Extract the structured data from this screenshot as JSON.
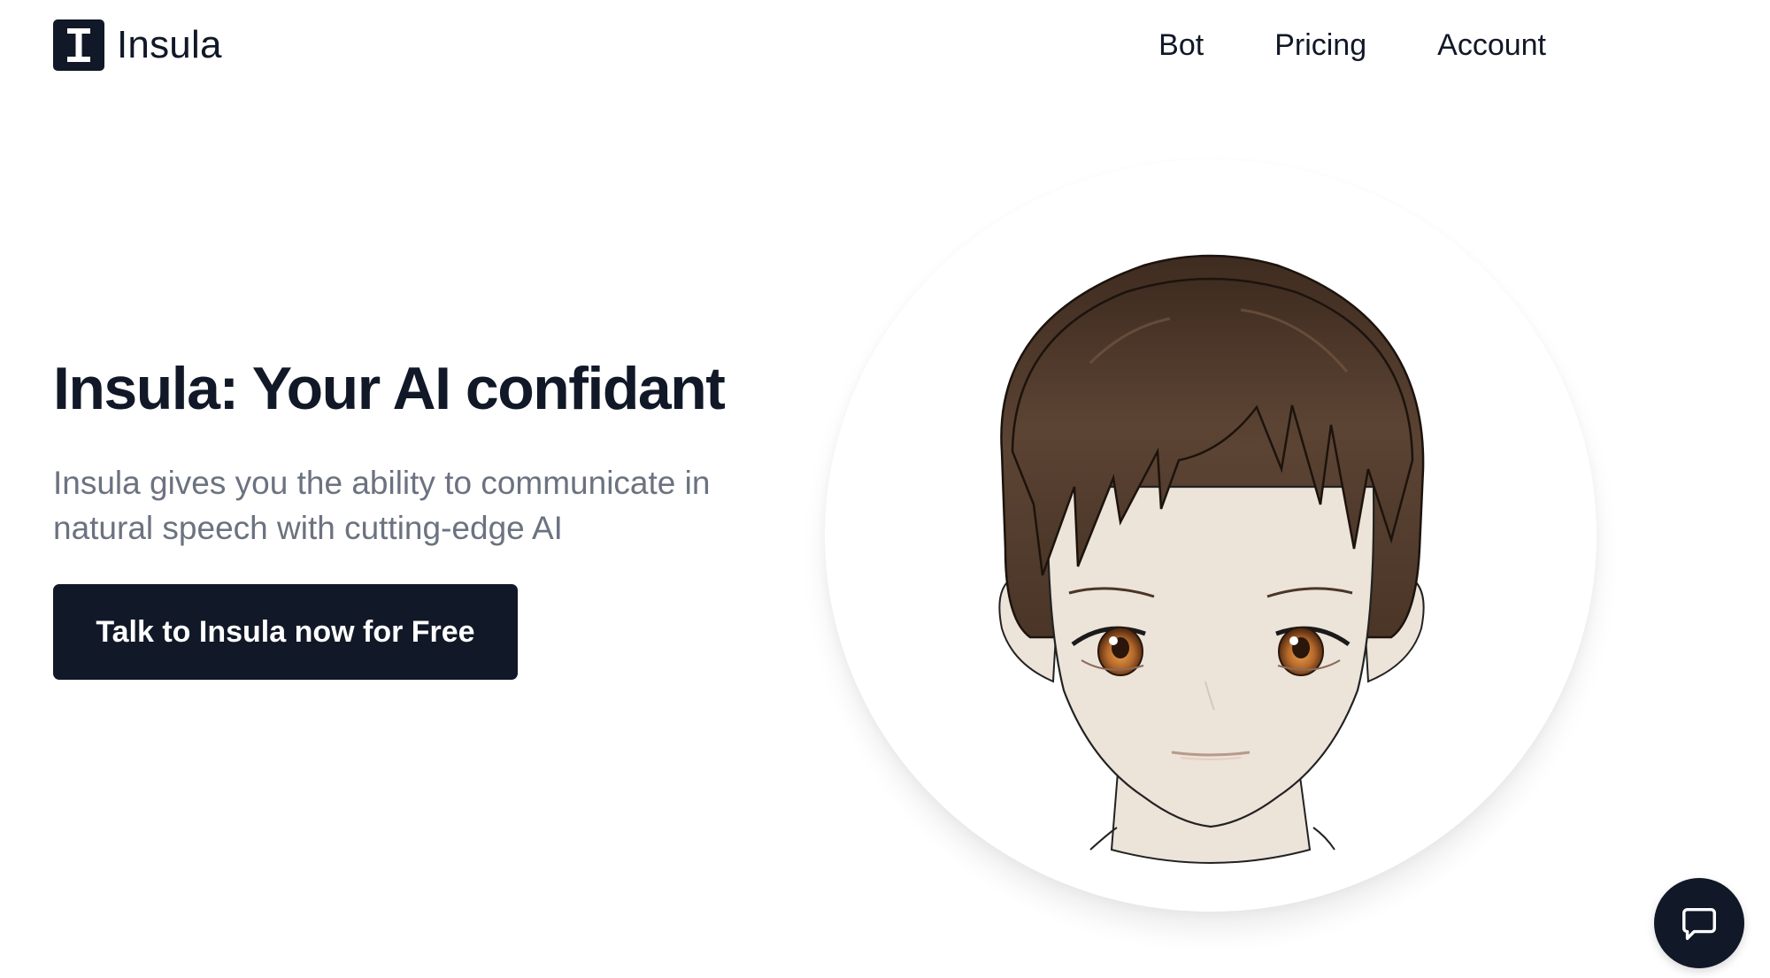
{
  "brand": {
    "name": "Insula",
    "logo_letter": "I"
  },
  "nav": {
    "items": [
      {
        "label": "Bot"
      },
      {
        "label": "Pricing"
      },
      {
        "label": "Account"
      }
    ]
  },
  "hero": {
    "title": "Insula: Your AI confidant",
    "subtitle": "Insula gives you the ability to communicate in natural speech with cutting-edge AI",
    "cta_label": "Talk to Insula now for Free"
  },
  "avatar": {
    "icon": "anime-avatar-face",
    "hair_color": "#5a4333",
    "skin_color": "#ece3d9",
    "eye_color": "#b8702e"
  },
  "chat": {
    "icon": "chat-bubble-icon"
  },
  "colors": {
    "primary": "#111827",
    "muted_text": "#6b7280",
    "background": "#ffffff"
  }
}
